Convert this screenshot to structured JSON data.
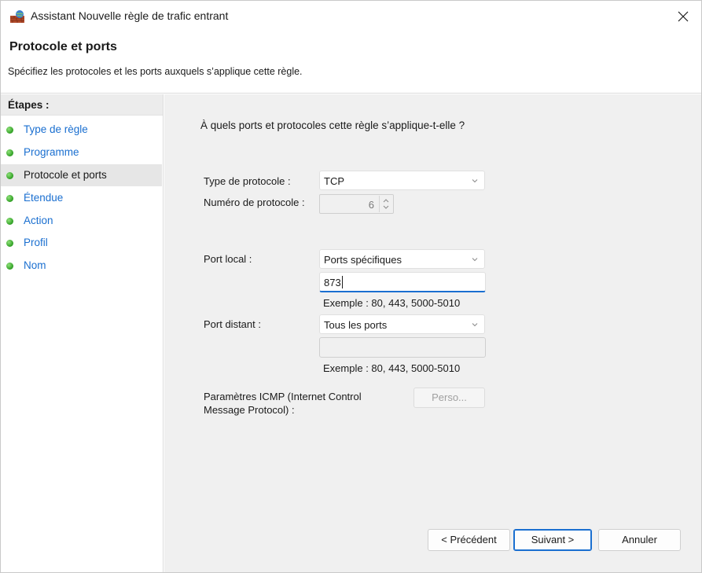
{
  "window": {
    "title": "Assistant Nouvelle règle de trafic entrant",
    "close_glyph": "✕"
  },
  "header": {
    "title": "Protocole et ports",
    "subtitle": "Spécifiez les protocoles et les ports auxquels s’applique cette règle."
  },
  "sidebar": {
    "heading": "Étapes :",
    "items": [
      {
        "label": "Type de règle",
        "active": false
      },
      {
        "label": "Programme",
        "active": false
      },
      {
        "label": "Protocole et ports",
        "active": true
      },
      {
        "label": "Étendue",
        "active": false
      },
      {
        "label": "Action",
        "active": false
      },
      {
        "label": "Profil",
        "active": false
      },
      {
        "label": "Nom",
        "active": false
      }
    ]
  },
  "main": {
    "question": "À quels ports et protocoles cette règle s’applique-t-elle ?",
    "protocol_type_label": "Type de protocole :",
    "protocol_type_value": "TCP",
    "protocol_number_label": "Numéro de protocole :",
    "protocol_number_value": "6",
    "local_port_label": "Port local :",
    "local_port_value": "Ports spécifiques",
    "local_port_input": "873",
    "local_port_example": "Exemple : 80, 443, 5000-5010",
    "remote_port_label": "Port distant :",
    "remote_port_value": "Tous les ports",
    "remote_port_input": "",
    "remote_port_example": "Exemple : 80, 443, 5000-5010",
    "icmp_label_line1": "Paramètres ICMP (Internet Control",
    "icmp_label_line2": "Message Protocol) :",
    "perso_button": "Perso..."
  },
  "footer": {
    "previous_button": "< Précédent",
    "next_button": "Suivant >",
    "cancel_button": "Annuler"
  },
  "colors": {
    "accent": "#1a6fd0",
    "step_dot": "#2f9e23",
    "main_bg": "#f0f0f0"
  },
  "icons": {
    "title": "firewall-icon",
    "close": "close-icon",
    "step": "green-dot-icon",
    "dropdown": "chevron-down-icon",
    "spin_up": "spin-up-icon",
    "spin_down": "spin-down-icon"
  }
}
